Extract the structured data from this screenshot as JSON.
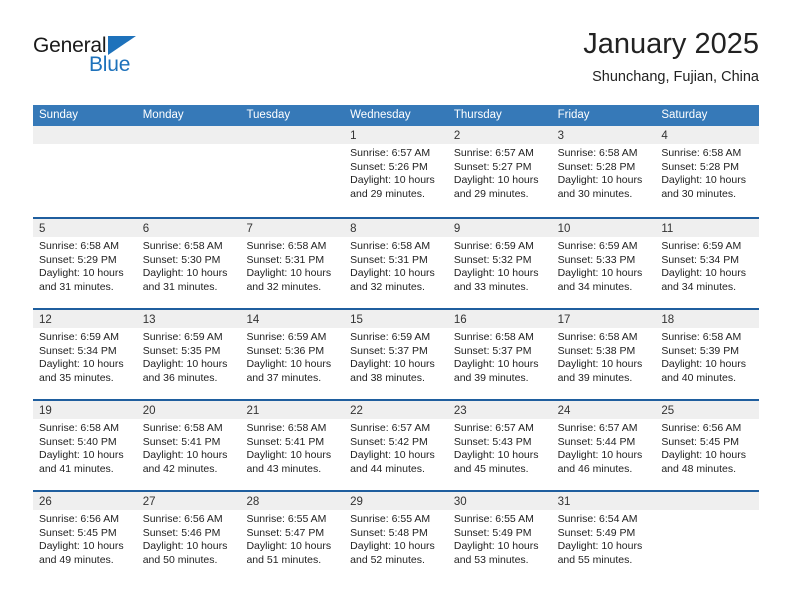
{
  "brand": {
    "name_part1": "General",
    "name_part2": "Blue",
    "accent_color": "#1e72bb"
  },
  "header": {
    "title": "January 2025",
    "subtitle": "Shunchang, Fujian, China"
  },
  "theme": {
    "header_row_bg": "#3679b8",
    "week_divider": "#1f5e9e",
    "day_band_bg": "#efefef"
  },
  "weekdays": [
    "Sunday",
    "Monday",
    "Tuesday",
    "Wednesday",
    "Thursday",
    "Friday",
    "Saturday"
  ],
  "weeks": [
    [
      {
        "day": "",
        "empty": true
      },
      {
        "day": "",
        "empty": true
      },
      {
        "day": "",
        "empty": true
      },
      {
        "day": "1",
        "sunrise": "Sunrise: 6:57 AM",
        "sunset": "Sunset: 5:26 PM",
        "daylight1": "Daylight: 10 hours",
        "daylight2": "and 29 minutes."
      },
      {
        "day": "2",
        "sunrise": "Sunrise: 6:57 AM",
        "sunset": "Sunset: 5:27 PM",
        "daylight1": "Daylight: 10 hours",
        "daylight2": "and 29 minutes."
      },
      {
        "day": "3",
        "sunrise": "Sunrise: 6:58 AM",
        "sunset": "Sunset: 5:28 PM",
        "daylight1": "Daylight: 10 hours",
        "daylight2": "and 30 minutes."
      },
      {
        "day": "4",
        "sunrise": "Sunrise: 6:58 AM",
        "sunset": "Sunset: 5:28 PM",
        "daylight1": "Daylight: 10 hours",
        "daylight2": "and 30 minutes."
      }
    ],
    [
      {
        "day": "5",
        "sunrise": "Sunrise: 6:58 AM",
        "sunset": "Sunset: 5:29 PM",
        "daylight1": "Daylight: 10 hours",
        "daylight2": "and 31 minutes."
      },
      {
        "day": "6",
        "sunrise": "Sunrise: 6:58 AM",
        "sunset": "Sunset: 5:30 PM",
        "daylight1": "Daylight: 10 hours",
        "daylight2": "and 31 minutes."
      },
      {
        "day": "7",
        "sunrise": "Sunrise: 6:58 AM",
        "sunset": "Sunset: 5:31 PM",
        "daylight1": "Daylight: 10 hours",
        "daylight2": "and 32 minutes."
      },
      {
        "day": "8",
        "sunrise": "Sunrise: 6:58 AM",
        "sunset": "Sunset: 5:31 PM",
        "daylight1": "Daylight: 10 hours",
        "daylight2": "and 32 minutes."
      },
      {
        "day": "9",
        "sunrise": "Sunrise: 6:59 AM",
        "sunset": "Sunset: 5:32 PM",
        "daylight1": "Daylight: 10 hours",
        "daylight2": "and 33 minutes."
      },
      {
        "day": "10",
        "sunrise": "Sunrise: 6:59 AM",
        "sunset": "Sunset: 5:33 PM",
        "daylight1": "Daylight: 10 hours",
        "daylight2": "and 34 minutes."
      },
      {
        "day": "11",
        "sunrise": "Sunrise: 6:59 AM",
        "sunset": "Sunset: 5:34 PM",
        "daylight1": "Daylight: 10 hours",
        "daylight2": "and 34 minutes."
      }
    ],
    [
      {
        "day": "12",
        "sunrise": "Sunrise: 6:59 AM",
        "sunset": "Sunset: 5:34 PM",
        "daylight1": "Daylight: 10 hours",
        "daylight2": "and 35 minutes."
      },
      {
        "day": "13",
        "sunrise": "Sunrise: 6:59 AM",
        "sunset": "Sunset: 5:35 PM",
        "daylight1": "Daylight: 10 hours",
        "daylight2": "and 36 minutes."
      },
      {
        "day": "14",
        "sunrise": "Sunrise: 6:59 AM",
        "sunset": "Sunset: 5:36 PM",
        "daylight1": "Daylight: 10 hours",
        "daylight2": "and 37 minutes."
      },
      {
        "day": "15",
        "sunrise": "Sunrise: 6:59 AM",
        "sunset": "Sunset: 5:37 PM",
        "daylight1": "Daylight: 10 hours",
        "daylight2": "and 38 minutes."
      },
      {
        "day": "16",
        "sunrise": "Sunrise: 6:58 AM",
        "sunset": "Sunset: 5:37 PM",
        "daylight1": "Daylight: 10 hours",
        "daylight2": "and 39 minutes."
      },
      {
        "day": "17",
        "sunrise": "Sunrise: 6:58 AM",
        "sunset": "Sunset: 5:38 PM",
        "daylight1": "Daylight: 10 hours",
        "daylight2": "and 39 minutes."
      },
      {
        "day": "18",
        "sunrise": "Sunrise: 6:58 AM",
        "sunset": "Sunset: 5:39 PM",
        "daylight1": "Daylight: 10 hours",
        "daylight2": "and 40 minutes."
      }
    ],
    [
      {
        "day": "19",
        "sunrise": "Sunrise: 6:58 AM",
        "sunset": "Sunset: 5:40 PM",
        "daylight1": "Daylight: 10 hours",
        "daylight2": "and 41 minutes."
      },
      {
        "day": "20",
        "sunrise": "Sunrise: 6:58 AM",
        "sunset": "Sunset: 5:41 PM",
        "daylight1": "Daylight: 10 hours",
        "daylight2": "and 42 minutes."
      },
      {
        "day": "21",
        "sunrise": "Sunrise: 6:58 AM",
        "sunset": "Sunset: 5:41 PM",
        "daylight1": "Daylight: 10 hours",
        "daylight2": "and 43 minutes."
      },
      {
        "day": "22",
        "sunrise": "Sunrise: 6:57 AM",
        "sunset": "Sunset: 5:42 PM",
        "daylight1": "Daylight: 10 hours",
        "daylight2": "and 44 minutes."
      },
      {
        "day": "23",
        "sunrise": "Sunrise: 6:57 AM",
        "sunset": "Sunset: 5:43 PM",
        "daylight1": "Daylight: 10 hours",
        "daylight2": "and 45 minutes."
      },
      {
        "day": "24",
        "sunrise": "Sunrise: 6:57 AM",
        "sunset": "Sunset: 5:44 PM",
        "daylight1": "Daylight: 10 hours",
        "daylight2": "and 46 minutes."
      },
      {
        "day": "25",
        "sunrise": "Sunrise: 6:56 AM",
        "sunset": "Sunset: 5:45 PM",
        "daylight1": "Daylight: 10 hours",
        "daylight2": "and 48 minutes."
      }
    ],
    [
      {
        "day": "26",
        "sunrise": "Sunrise: 6:56 AM",
        "sunset": "Sunset: 5:45 PM",
        "daylight1": "Daylight: 10 hours",
        "daylight2": "and 49 minutes."
      },
      {
        "day": "27",
        "sunrise": "Sunrise: 6:56 AM",
        "sunset": "Sunset: 5:46 PM",
        "daylight1": "Daylight: 10 hours",
        "daylight2": "and 50 minutes."
      },
      {
        "day": "28",
        "sunrise": "Sunrise: 6:55 AM",
        "sunset": "Sunset: 5:47 PM",
        "daylight1": "Daylight: 10 hours",
        "daylight2": "and 51 minutes."
      },
      {
        "day": "29",
        "sunrise": "Sunrise: 6:55 AM",
        "sunset": "Sunset: 5:48 PM",
        "daylight1": "Daylight: 10 hours",
        "daylight2": "and 52 minutes."
      },
      {
        "day": "30",
        "sunrise": "Sunrise: 6:55 AM",
        "sunset": "Sunset: 5:49 PM",
        "daylight1": "Daylight: 10 hours",
        "daylight2": "and 53 minutes."
      },
      {
        "day": "31",
        "sunrise": "Sunrise: 6:54 AM",
        "sunset": "Sunset: 5:49 PM",
        "daylight1": "Daylight: 10 hours",
        "daylight2": "and 55 minutes."
      },
      {
        "day": "",
        "empty": true
      }
    ]
  ]
}
